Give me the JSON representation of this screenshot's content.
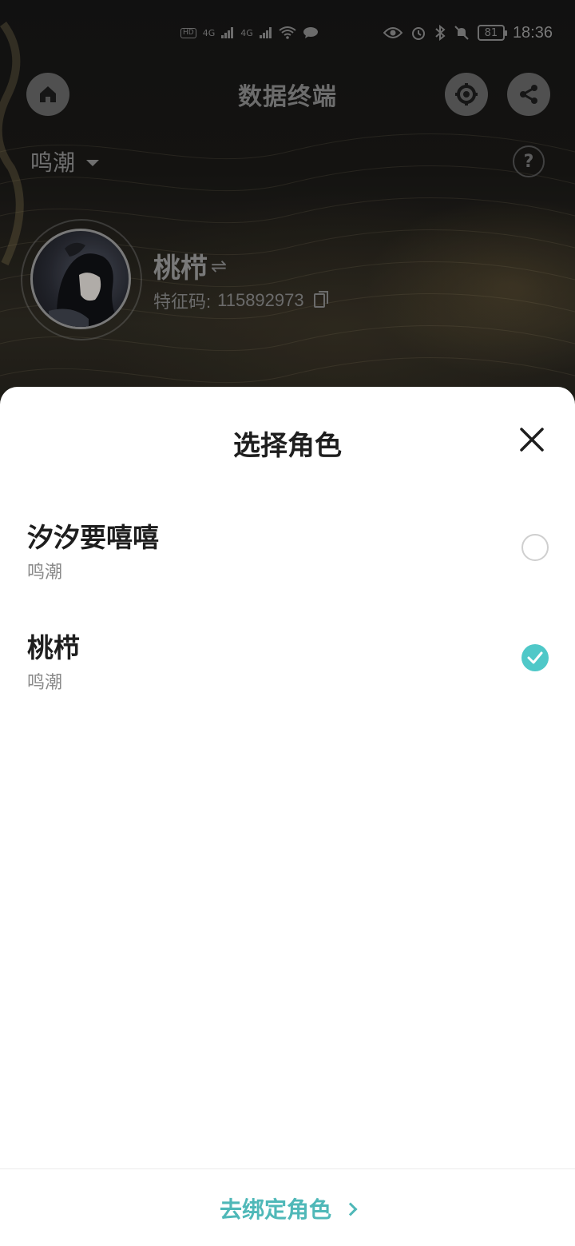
{
  "status_bar": {
    "time": "18:36",
    "battery": "81",
    "left_badges": [
      "HD",
      "4G",
      "4G"
    ],
    "icons": [
      "signal-icon",
      "wifi-icon",
      "chat-icon",
      "eye-icon",
      "alarm-icon",
      "bluetooth-icon",
      "mute-icon",
      "battery-icon"
    ]
  },
  "header": {
    "title": "数据终端",
    "home_icon": "home-icon",
    "settings_icon": "gear-icon",
    "share_icon": "share-icon"
  },
  "game_selector": {
    "selected": "鸣潮"
  },
  "help": {
    "label": "?"
  },
  "profile": {
    "name": "桃栉",
    "swap_symbol": "⇌",
    "code_label": "特征码:",
    "code_value": "115892973"
  },
  "sheet": {
    "title": "选择角色",
    "roles": [
      {
        "name": "汐汐要嘻嘻",
        "game": "鸣潮",
        "selected": false
      },
      {
        "name": "桃栉",
        "game": "鸣潮",
        "selected": true
      }
    ],
    "bind_link": "去绑定角色"
  },
  "colors": {
    "accent": "#4fc8c8",
    "link": "#4fb8b8"
  }
}
